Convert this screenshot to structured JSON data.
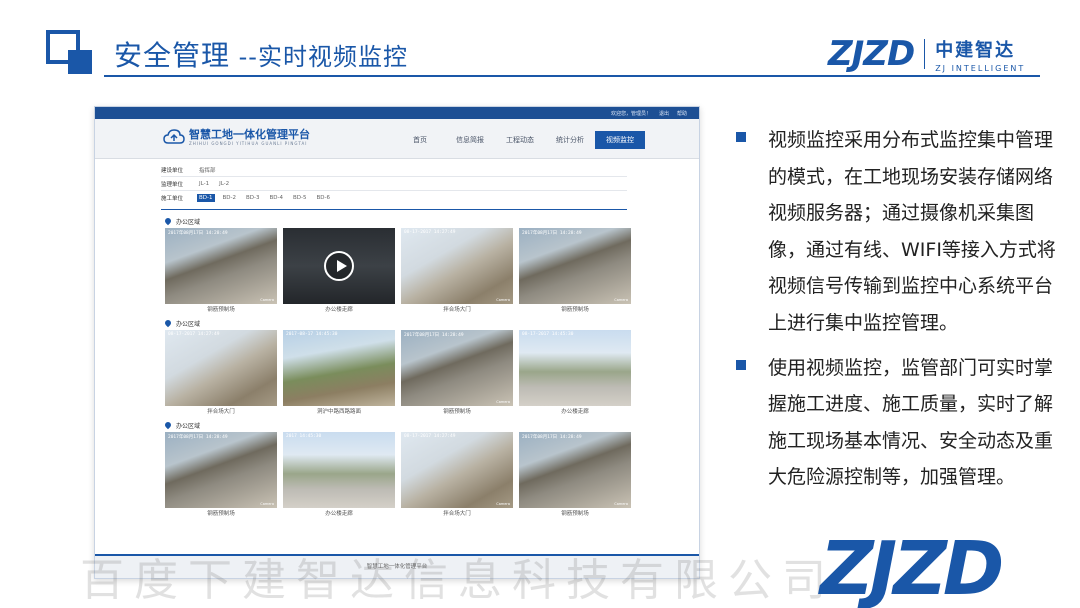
{
  "slide": {
    "title": "安全管理",
    "subtitle": " --实时视频监控",
    "brand_mark": "ZJZD",
    "brand_cn": "中建智达",
    "brand_en": "ZJ INTELLIGENT"
  },
  "screenshot": {
    "topbar": [
      "欢迎您，管理员！",
      "退出",
      "帮助"
    ],
    "platform_name": "智慧工地一体化管理平台",
    "platform_en": "ZHIHUI GONGDI YITIHUA GUANLI PINGTAI",
    "nav": [
      "首页",
      "信息简报",
      "工程动态",
      "统计分析",
      "视频监控"
    ],
    "filters": [
      {
        "label": "建设单位",
        "options": [
          "指挥部"
        ]
      },
      {
        "label": "监理单位",
        "options": [
          "JL-1",
          "JL-2"
        ]
      },
      {
        "label": "施工单位",
        "options": [
          "BD-1",
          "BD-2",
          "BD-3",
          "BD-4",
          "BD-5",
          "BD-6"
        ]
      }
    ],
    "sections": [
      {
        "title": "办公区域",
        "cells": [
          {
            "caption": "钢筋预制场",
            "ts": "2017年08月17日 14:28:49"
          },
          {
            "caption": "办公楼走廊",
            "ts": ""
          },
          {
            "caption": "拌合场大门",
            "ts": "08-17-2017 14:27:49"
          },
          {
            "caption": "钢筋预制场",
            "ts": "2017年08月17日 14:28:49"
          }
        ]
      },
      {
        "title": "办公区域",
        "cells": [
          {
            "caption": "拌合场大门",
            "ts": "08-17-2017 14:27:49"
          },
          {
            "caption": "洞沪中路西路路面",
            "ts": "2017-08-17 14:45:30"
          },
          {
            "caption": "钢筋预制场",
            "ts": "2017年08月17日 14:28:49"
          },
          {
            "caption": "办公楼走廊",
            "ts": "08-17-2017 14:45:30"
          }
        ]
      },
      {
        "title": "办公区域",
        "cells": [
          {
            "caption": "钢筋预制场",
            "ts": "2017年08月17日 14:28:49"
          },
          {
            "caption": "办公楼走廊",
            "ts": "2017 14:45:30"
          },
          {
            "caption": "拌合场大门",
            "ts": "08-17-2017 14:27:49"
          },
          {
            "caption": "钢筋预制场",
            "ts": "2017年08月17日 14:28:49"
          }
        ]
      }
    ],
    "footer": "智慧工地一体化管理平台",
    "active_nav": "视频监控",
    "selected_filter": "BD-1"
  },
  "bullets": [
    "视频监控采用分布式监控集中管理的模式，在工地现场安装存储网络视频服务器；通过摄像机采集图像，通过有线、WIFI等接入方式将视频信号传输到监控中心系统平台上进行集中监控管理。",
    "使用视频监控，监管部门可实时掌握施工进度、施工质量，实时了解施工现场基本情况、安全动态及重大危险源控制等，加强管理。"
  ],
  "watermark": "百度下建智达信息科技有限公司",
  "big_logo": "ZJZD",
  "colors": {
    "accent": "#1a57a8"
  }
}
